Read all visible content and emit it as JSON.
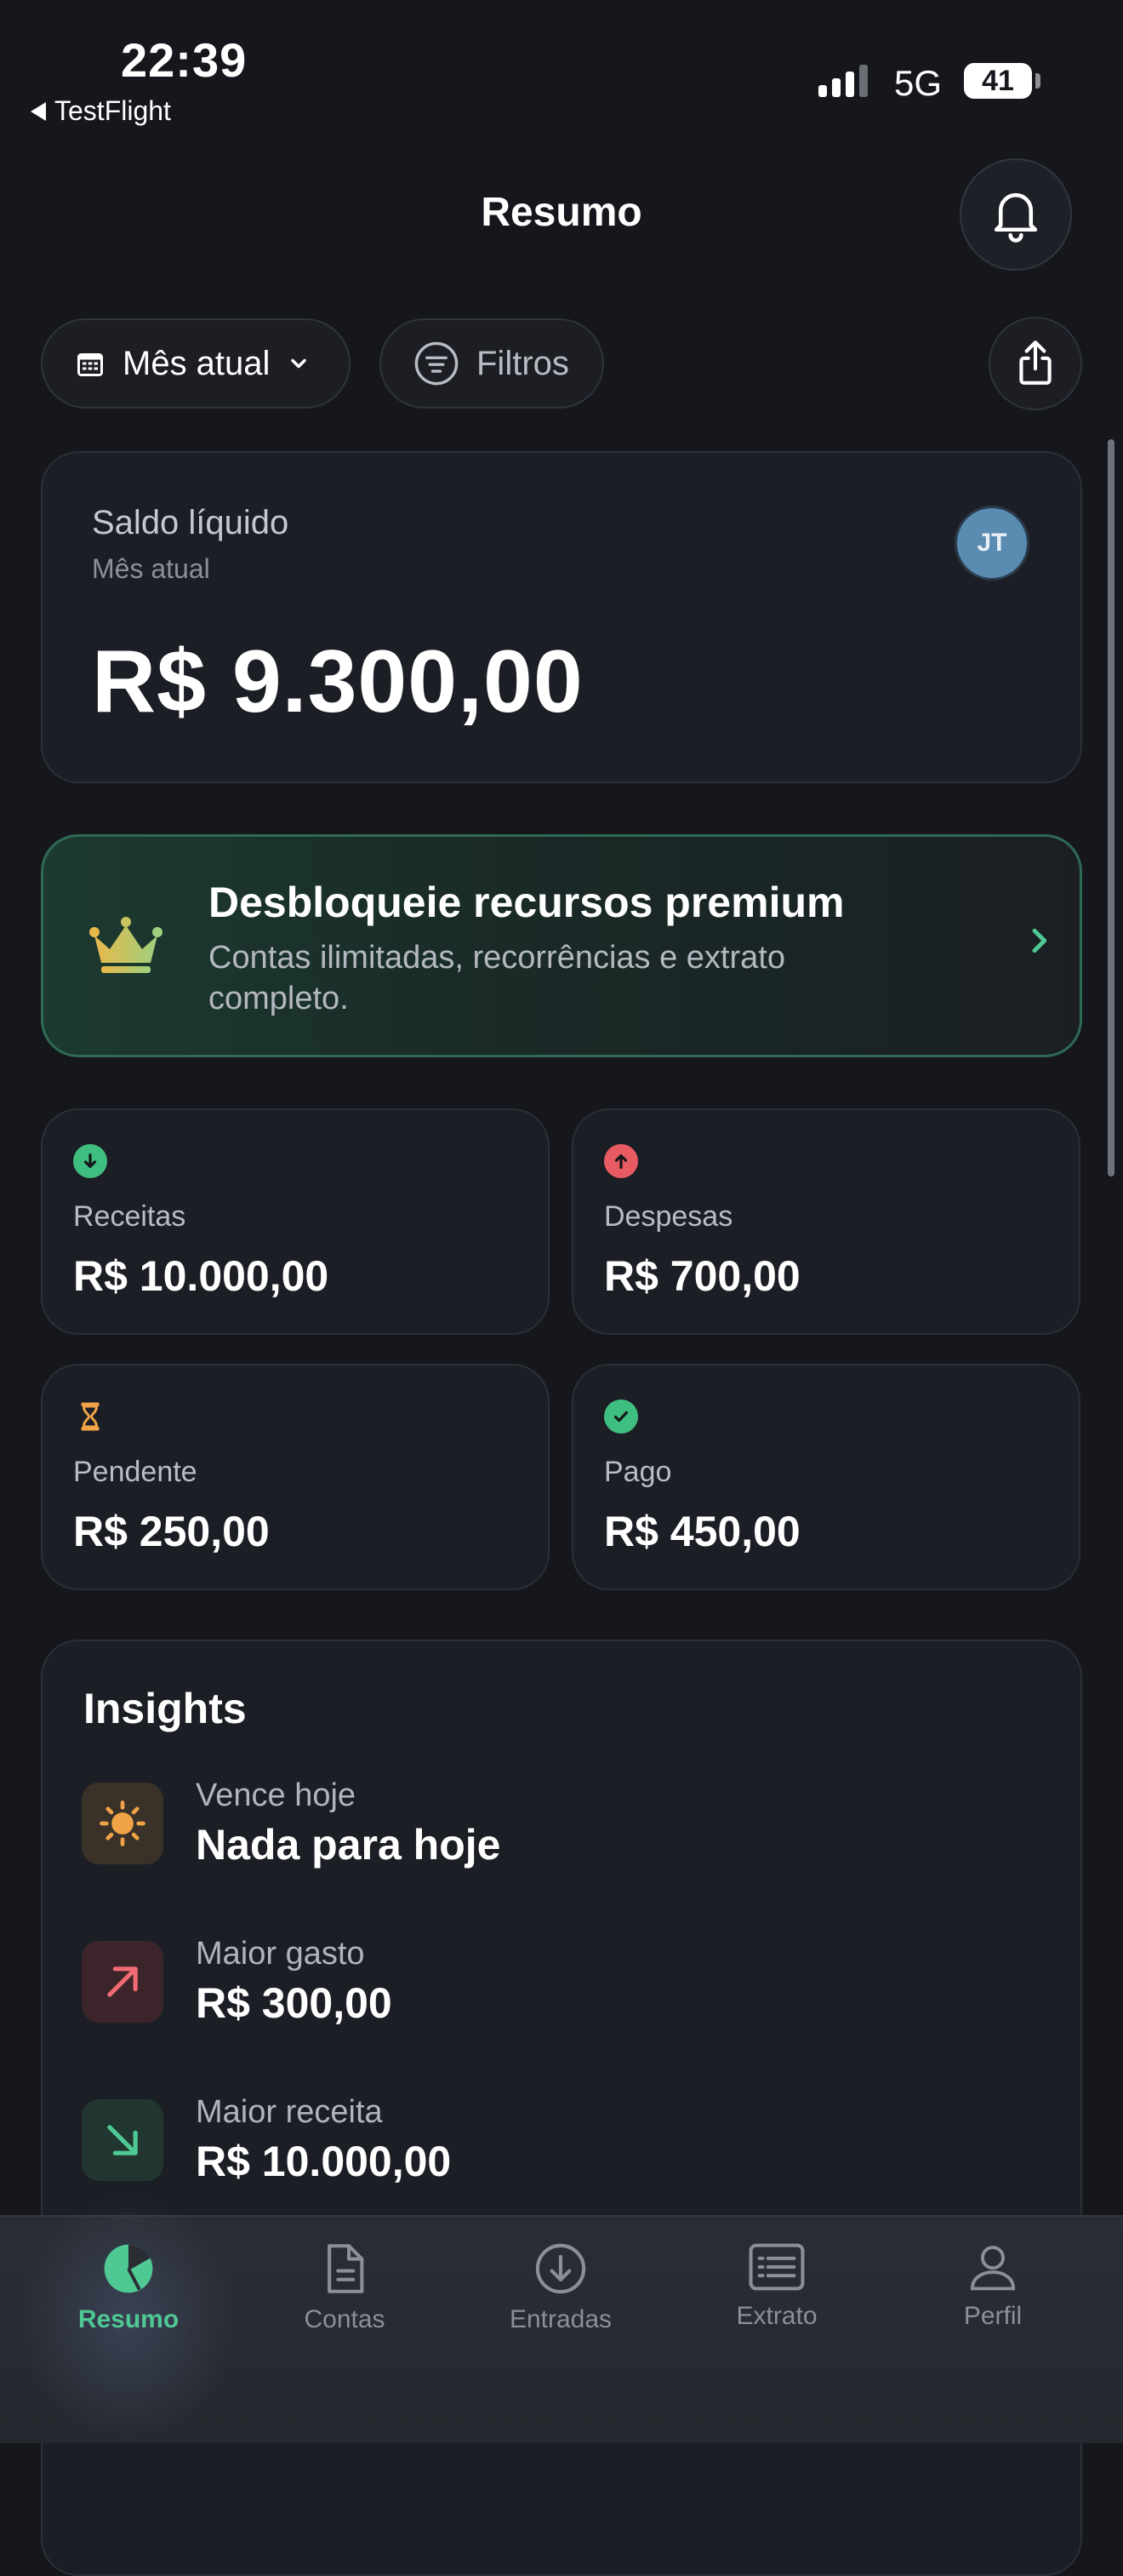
{
  "status_bar": {
    "time": "22:39",
    "back_app": "TestFlight",
    "network": "5G",
    "battery": "41"
  },
  "header": {
    "title": "Resumo"
  },
  "filters": {
    "period": "Mês atual",
    "filter_label": "Filtros"
  },
  "balance": {
    "title": "Saldo líquido",
    "subtitle": "Mês atual",
    "value": "R$ 9.300,00",
    "avatar_initials": "JT"
  },
  "premium": {
    "title": "Desbloqueie recursos premium",
    "subtitle": "Contas ilimitadas, recorrências e extrato completo."
  },
  "stats": [
    {
      "label": "Receitas",
      "value": "R$ 10.000,00",
      "icon": "arrow-down-circle-icon",
      "color": "#3fbf7f"
    },
    {
      "label": "Despesas",
      "value": "R$ 700,00",
      "icon": "arrow-up-circle-icon",
      "color": "#e85b62"
    },
    {
      "label": "Pendente",
      "value": "R$ 250,00",
      "icon": "hourglass-icon",
      "color": "#f0a447"
    },
    {
      "label": "Pago",
      "value": "R$ 450,00",
      "icon": "check-circle-icon",
      "color": "#3fbf7f"
    }
  ],
  "insights": {
    "title": "Insights",
    "items": [
      {
        "label": "Vence hoje",
        "value": "Nada para hoje",
        "icon": "sun-icon"
      },
      {
        "label": "Maior gasto",
        "value": "R$ 300,00",
        "icon": "arrow-up-right-icon"
      },
      {
        "label": "Maior receita",
        "value": "R$ 10.000,00",
        "icon": "arrow-down-right-icon"
      }
    ]
  },
  "tabs": [
    {
      "label": "Resumo",
      "icon": "pie-chart-icon",
      "active": true
    },
    {
      "label": "Contas",
      "icon": "document-icon"
    },
    {
      "label": "Entradas",
      "icon": "arrow-down-circle-icon"
    },
    {
      "label": "Extrato",
      "icon": "list-icon"
    },
    {
      "label": "Perfil",
      "icon": "person-icon"
    }
  ],
  "colors": {
    "accent": "#4fc894",
    "background": "#15171c",
    "card": "#1c1e25"
  }
}
